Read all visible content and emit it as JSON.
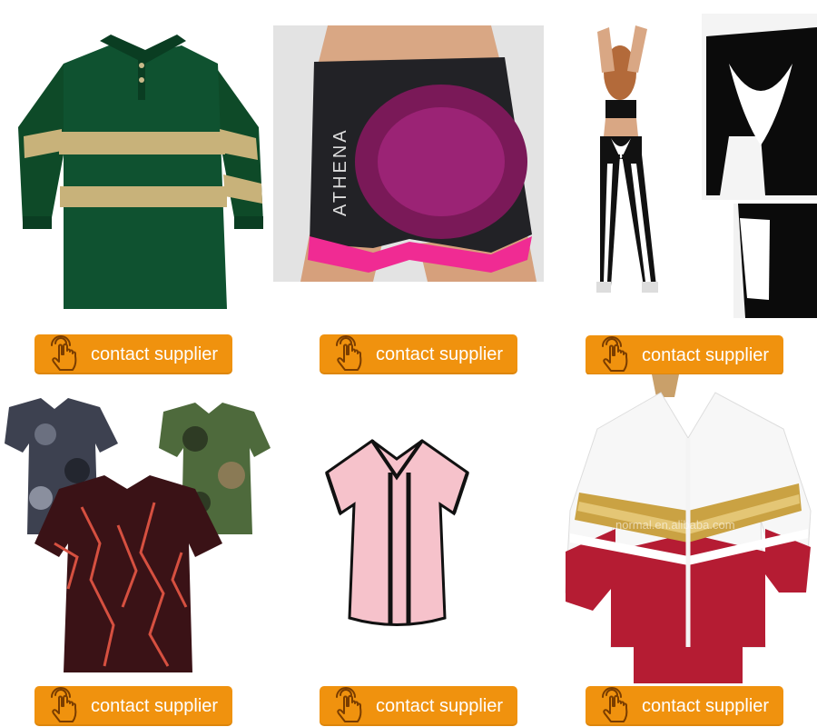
{
  "grid": {
    "cta_label": "contact supplier",
    "cta_icon": "hand-pointer-icon",
    "cta_color": "#f0920e",
    "products": [
      {
        "id": "rugby-shirt",
        "cta": "contact supplier"
      },
      {
        "id": "athena-shorts",
        "cta": "contact supplier",
        "brand_text": "ATHENA"
      },
      {
        "id": "heart-leggings",
        "cta": "contact supplier"
      },
      {
        "id": "camo-tshirts",
        "cta": "contact supplier"
      },
      {
        "id": "baseball-jersey",
        "cta": "contact supplier"
      },
      {
        "id": "cheer-jacket",
        "cta": "contact supplier",
        "watermark": "normal.en.alibaba.com"
      }
    ]
  }
}
